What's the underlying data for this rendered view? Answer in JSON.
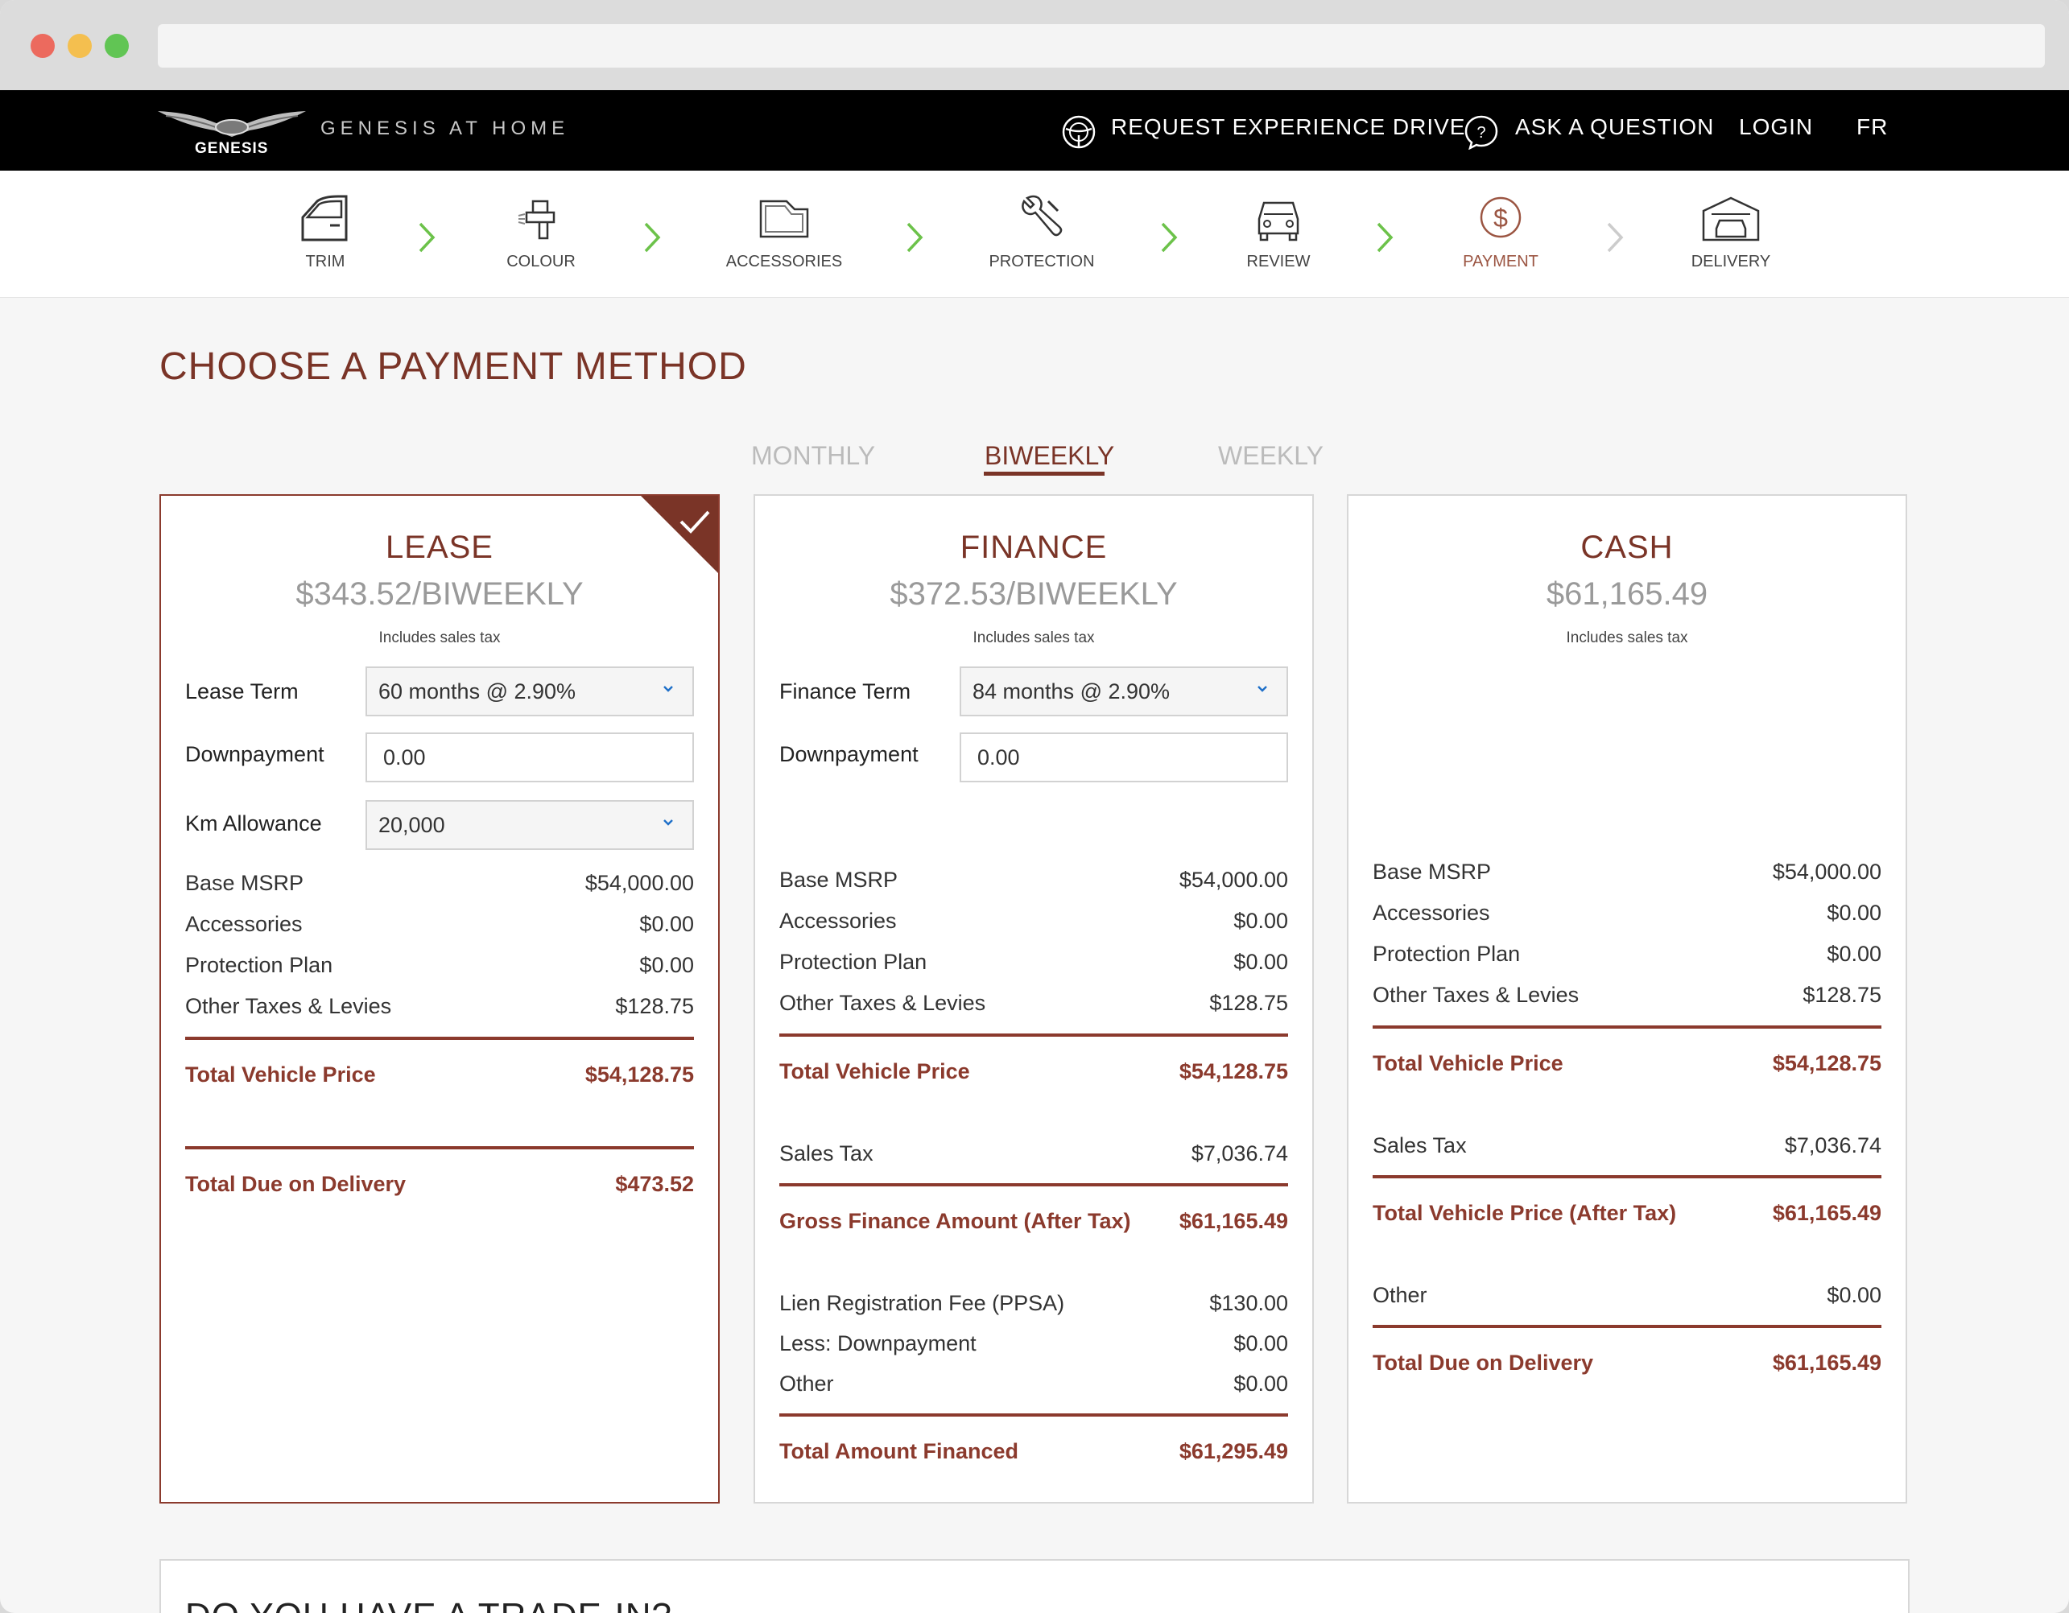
{
  "browser": {
    "address": ""
  },
  "brand": {
    "logo_text": "GENESIS",
    "site_name": "GENESIS AT HOME"
  },
  "topnav": {
    "request_drive": "REQUEST EXPERIENCE DRIVE",
    "ask_question": "ASK A QUESTION",
    "login": "LOGIN",
    "lang": "FR"
  },
  "steps": [
    {
      "label": "TRIM",
      "icon": "car-door-icon"
    },
    {
      "label": "COLOUR",
      "icon": "spray-gun-icon"
    },
    {
      "label": "ACCESSORIES",
      "icon": "car-mat-icon"
    },
    {
      "label": "PROTECTION",
      "icon": "wrench-icon"
    },
    {
      "label": "REVIEW",
      "icon": "car-front-icon"
    },
    {
      "label": "PAYMENT",
      "icon": "dollar-circle-icon",
      "active": true
    },
    {
      "label": "DELIVERY",
      "icon": "garage-icon"
    }
  ],
  "page_title": "CHOOSE A PAYMENT METHOD",
  "frequency": {
    "monthly": "MONTHLY",
    "biweekly": "BIWEEKLY",
    "weekly": "WEEKLY",
    "selected": "BIWEEKLY"
  },
  "lease": {
    "title": "LEASE",
    "price": "$343.52/BIWEEKLY",
    "tax_note": "Includes sales tax",
    "term_label": "Lease Term",
    "term_value": "60 months @ 2.90%",
    "down_label": "Downpayment",
    "down_value": "0.00",
    "km_label": "Km Allowance",
    "km_value": "20,000",
    "rows": [
      {
        "label": "Base MSRP",
        "value": "$54,000.00"
      },
      {
        "label": "Accessories",
        "value": "$0.00"
      },
      {
        "label": "Protection Plan",
        "value": "$0.00"
      },
      {
        "label": "Other Taxes & Levies",
        "value": "$128.75"
      }
    ],
    "total_vehicle_label": "Total Vehicle Price",
    "total_vehicle_value": "$54,128.75",
    "total_due_label": "Total Due on Delivery",
    "total_due_value": "$473.52"
  },
  "finance": {
    "title": "FINANCE",
    "price": "$372.53/BIWEEKLY",
    "tax_note": "Includes sales tax",
    "term_label": "Finance Term",
    "term_value": "84 months @ 2.90%",
    "down_label": "Downpayment",
    "down_value": "0.00",
    "rows": [
      {
        "label": "Base MSRP",
        "value": "$54,000.00"
      },
      {
        "label": "Accessories",
        "value": "$0.00"
      },
      {
        "label": "Protection Plan",
        "value": "$0.00"
      },
      {
        "label": "Other Taxes & Levies",
        "value": "$128.75"
      }
    ],
    "total_vehicle_label": "Total Vehicle Price",
    "total_vehicle_value": "$54,128.75",
    "sales_tax_label": "Sales Tax",
    "sales_tax_value": "$7,036.74",
    "gross_label": "Gross Finance Amount (After Tax)",
    "gross_value": "$61,165.49",
    "fees": [
      {
        "label": "Lien Registration Fee (PPSA)",
        "value": "$130.00"
      },
      {
        "label": "Less: Downpayment",
        "value": "$0.00"
      },
      {
        "label": "Other",
        "value": "$0.00"
      }
    ],
    "total_financed_label": "Total Amount Financed",
    "total_financed_value": "$61,295.49"
  },
  "cash": {
    "title": "CASH",
    "price": "$61,165.49",
    "tax_note": "Includes sales tax",
    "rows": [
      {
        "label": "Base MSRP",
        "value": "$54,000.00"
      },
      {
        "label": "Accessories",
        "value": "$0.00"
      },
      {
        "label": "Protection Plan",
        "value": "$0.00"
      },
      {
        "label": "Other Taxes & Levies",
        "value": "$128.75"
      }
    ],
    "total_vehicle_label": "Total Vehicle Price",
    "total_vehicle_value": "$54,128.75",
    "sales_tax_label": "Sales Tax",
    "sales_tax_value": "$7,036.74",
    "after_tax_label": "Total Vehicle Price (After Tax)",
    "after_tax_value": "$61,165.49",
    "other_label": "Other",
    "other_value": "$0.00",
    "total_due_label": "Total Due on Delivery",
    "total_due_value": "$61,165.49"
  },
  "tradein": {
    "title": "DO YOU HAVE A TRADE-IN?"
  },
  "colors": {
    "accent": "#7a3427",
    "step_done": "#6cc24a",
    "step_todo": "#cccccc"
  }
}
